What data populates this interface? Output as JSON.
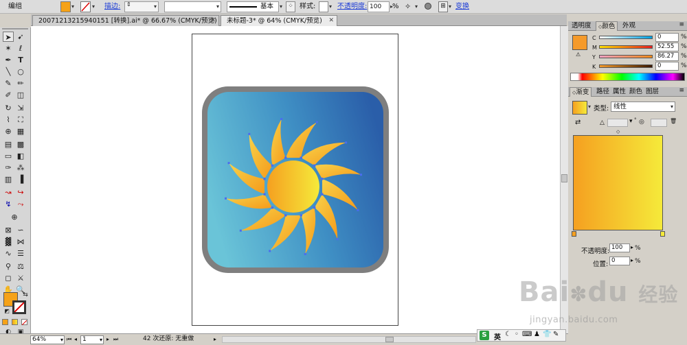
{
  "control_bar": {
    "mode": "编组",
    "stroke_label": "描边:",
    "stroke_profile": "基本",
    "style_label": "样式:",
    "opacity_label": "不透明度:",
    "opacity_value": "100",
    "opacity_unit": "%",
    "transform_label": "变换",
    "fill_color": "#f5a218"
  },
  "doc_tabs": [
    {
      "label": "20071213215940151 [转换].ai* @ 66.67% (CMYK/预览)"
    },
    {
      "label": "未标题-3* @ 64% (CMYK/预览)"
    }
  ],
  "toolbox": {
    "fill_color": "#f5a218"
  },
  "color_panel": {
    "tabs": [
      "透明度",
      "颜色",
      "外观"
    ],
    "swatch_color": "#f59a2a",
    "channels": [
      {
        "name": "C",
        "value": "0"
      },
      {
        "name": "M",
        "value": "52.55"
      },
      {
        "name": "Y",
        "value": "86.27"
      },
      {
        "name": "K",
        "value": "0"
      }
    ]
  },
  "gradient_panel": {
    "tabs": [
      "渐变",
      "路径",
      "属性",
      "颜色",
      "图层"
    ],
    "type_label": "类型:",
    "type_value": "线性",
    "gradient_start": "#f5a020",
    "gradient_end": "#f5ea3a",
    "opacity_label": "不透明度:",
    "opacity_value": "100",
    "location_label": "位置:",
    "location_value": "0",
    "percent": "%"
  },
  "status_bar": {
    "zoom": "64%",
    "page": "1",
    "undo_text": "42 次还原: 无重做"
  },
  "ime_bar": {
    "lang": "英"
  },
  "watermark": {
    "brand": "Bai",
    "brand_suffix": "du",
    "cn": "经验",
    "url": "jingyan.baidu.com"
  }
}
